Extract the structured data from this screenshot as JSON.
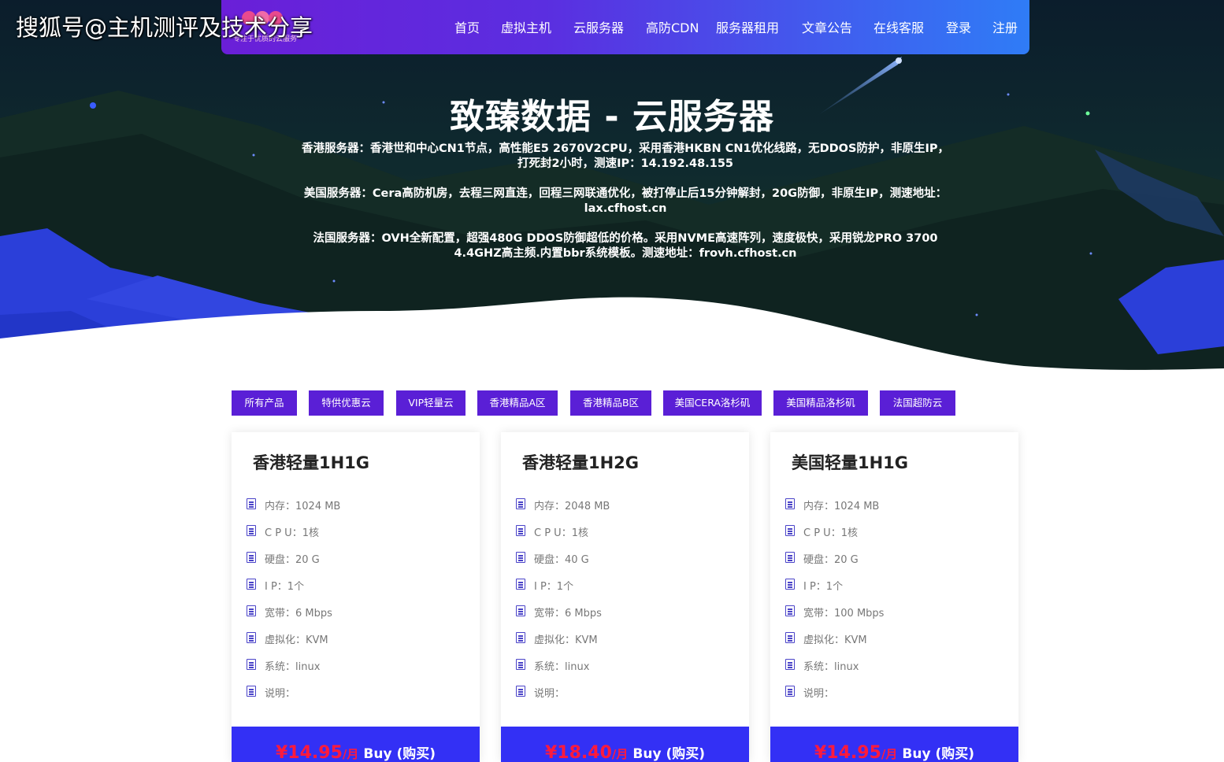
{
  "watermark": "搜狐号@主机测评及技术分享",
  "logo": {
    "tagline": "专注于优质的云服务"
  },
  "nav": {
    "items": [
      "首页",
      "虚拟主机",
      "云服务器",
      "高防CDN",
      "服务器租用",
      "文章公告",
      "在线客服",
      "登录",
      "注册"
    ]
  },
  "hero": {
    "title": "致臻数据 - 云服务器",
    "descriptions": [
      "香港服务器：香港世和中心CN1节点，高性能E5 2670V2CPU，采用香港HKBN CN1优化线路，无DDOS防护，非原生IP，打死封2小时，测速IP：14.192.48.155",
      "美国服务器：Cera高防机房，去程三网直连，回程三网联通优化，被打停止后15分钟解封，20G防御，非原生IP，测速地址：lax.cfhost.cn",
      "法国服务器：OVH全新配置，超强480G DDOS防御超低的价格。采用NVME高速阵列，速度极快，采用锐龙PRO 3700 4.4GHZ高主频.内置bbr系统模板。测速地址：frovh.cfhost.cn"
    ]
  },
  "filters": [
    "所有产品",
    "特供优惠云",
    "VIP轻量云",
    "香港精品A区",
    "香港精品B区",
    "美国CERA洛杉矶",
    "美国精品洛杉矶",
    "法国超防云"
  ],
  "cards": [
    {
      "title": "香港轻量1H1G",
      "specs": [
        "内存：1024 MB",
        "C P U：1核",
        "硬盘：20 G",
        "I P：1个",
        "宽带：6 Mbps",
        "虚拟化：KVM",
        "系统：linux",
        "说明："
      ],
      "price": "¥14.95",
      "per": "/月",
      "buy": "Buy (购买)"
    },
    {
      "title": "香港轻量1H2G",
      "specs": [
        "内存：2048 MB",
        "C P U：1核",
        "硬盘：40 G",
        "I P：1个",
        "宽带：6 Mbps",
        "虚拟化：KVM",
        "系统：linux",
        "说明："
      ],
      "price": "¥18.40",
      "per": "/月",
      "buy": "Buy (购买)"
    },
    {
      "title": "美国轻量1H1G",
      "specs": [
        "内存：1024 MB",
        "C P U：1核",
        "硬盘：20 G",
        "I P：1个",
        "宽带：100 Mbps",
        "虚拟化：KVM",
        "系统：linux",
        "说明："
      ],
      "price": "¥14.95",
      "per": "/月",
      "buy": "Buy (购买)"
    }
  ],
  "colors": {
    "accent": "#5a1fd6",
    "buy_bar": "#3330f5",
    "price": "#ff1a3c",
    "spec_icon": "#4a43c8"
  },
  "icons": {
    "spec": "document-list-icon",
    "logo": "brand-logo-icon"
  }
}
